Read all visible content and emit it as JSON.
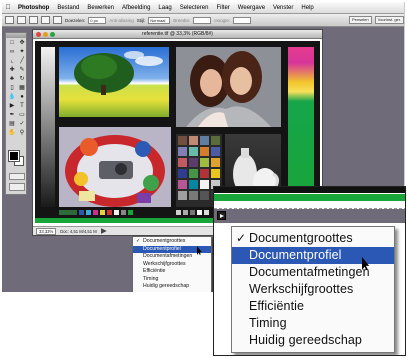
{
  "menubar": {
    "items": [
      "Photoshop",
      "Bestand",
      "Bewerken",
      "Afbeelding",
      "Laag",
      "Selecteren",
      "Filter",
      "Weergave",
      "Venster",
      "Help"
    ]
  },
  "options_bar": {
    "feather_label": "Doezelen:",
    "feather_value": "0 px",
    "antialias_label": "Anti-aliasing",
    "style_label": "Stijl:",
    "style_value": "Normaal",
    "width_label": "Breedte:",
    "height_label": "Hoogte:",
    "palette_buttons": [
      "Penselen",
      "Voorinst. ger."
    ]
  },
  "document": {
    "title": "referentie.tif @ 33,3% (RGB/8#)",
    "zoom": "33,33%",
    "status_text": "Doc: 4,51 M/4,51 M",
    "colors": {
      "green": "#18a53a",
      "accent": "#2b57b5"
    }
  },
  "status_menu": {
    "items": [
      {
        "label": "Documentgroottes",
        "checked": true,
        "highlighted": false
      },
      {
        "label": "Documentprofiel",
        "checked": false,
        "highlighted": true
      },
      {
        "label": "Documentafmetingen",
        "checked": false,
        "highlighted": false
      },
      {
        "label": "Werkschijfgroottes",
        "checked": false,
        "highlighted": false
      },
      {
        "label": "Efficiëntie",
        "checked": false,
        "highlighted": false
      },
      {
        "label": "Timing",
        "checked": false,
        "highlighted": false
      },
      {
        "label": "Huidig gereedschap",
        "checked": false,
        "highlighted": false
      }
    ],
    "check_glyph": "✓"
  },
  "icons": {
    "apple": "apple-icon",
    "menu_arrow": "triangle-right-icon",
    "cursor": "pointer-cursor-icon"
  }
}
